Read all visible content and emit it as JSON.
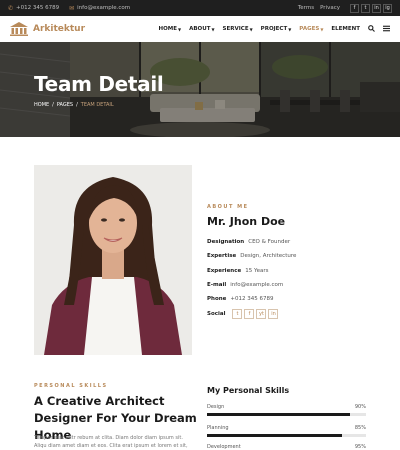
{
  "topbar": {
    "phone": "+012 345 6789",
    "email": "info@example.com",
    "links": [
      "Terms",
      "Privacy"
    ],
    "social": [
      "f",
      "t",
      "in",
      "ig"
    ]
  },
  "brand": {
    "name": "Arkitektur",
    "accent": "#b88a5a"
  },
  "menu": [
    {
      "label": "HOME",
      "caret": true,
      "active": false
    },
    {
      "label": "ABOUT",
      "caret": true,
      "active": false
    },
    {
      "label": "SERVICE",
      "caret": true,
      "active": false
    },
    {
      "label": "PROJECT",
      "caret": true,
      "active": false
    },
    {
      "label": "PAGES",
      "caret": true,
      "active": true
    },
    {
      "label": "ELEMENT",
      "caret": false,
      "active": false
    }
  ],
  "hero": {
    "title": "Team Detail",
    "breadcrumb": [
      "HOME",
      "/",
      "PAGES",
      "/",
      "TEAM DETAIL"
    ]
  },
  "profile": {
    "label": "ABOUT ME",
    "name": "Mr. Jhon Doe",
    "rows": [
      {
        "key": "Designation",
        "value": "CEO & Founder"
      },
      {
        "key": "Expertise",
        "value": "Design, Architecture"
      },
      {
        "key": "Experience",
        "value": "15 Years"
      },
      {
        "key": "E-mail",
        "value": "info@example.com"
      },
      {
        "key": "Phone",
        "value": "+012 345 6789"
      },
      {
        "key": "Social",
        "value": ""
      }
    ],
    "social": [
      "t",
      "f",
      "yt",
      "in"
    ]
  },
  "personal": {
    "label": "PERSONAL SKILLS",
    "title": "A Creative Architect Designer For Your Dream Home",
    "text": "Tempor erat elitr rebum at clita. Diam dolor diam ipsum sit. Aliqu diam amet diam et eos. Clita erat ipsum et lorem et sit, sed stet lorem sit clita"
  },
  "skills": {
    "title": "My Personal Skills",
    "items": [
      {
        "name": "Design",
        "percent": "90%",
        "value": 0.9
      },
      {
        "name": "Planning",
        "percent": "85%",
        "value": 0.85
      },
      {
        "name": "Development",
        "percent": "95%",
        "value": 0.95
      }
    ]
  }
}
